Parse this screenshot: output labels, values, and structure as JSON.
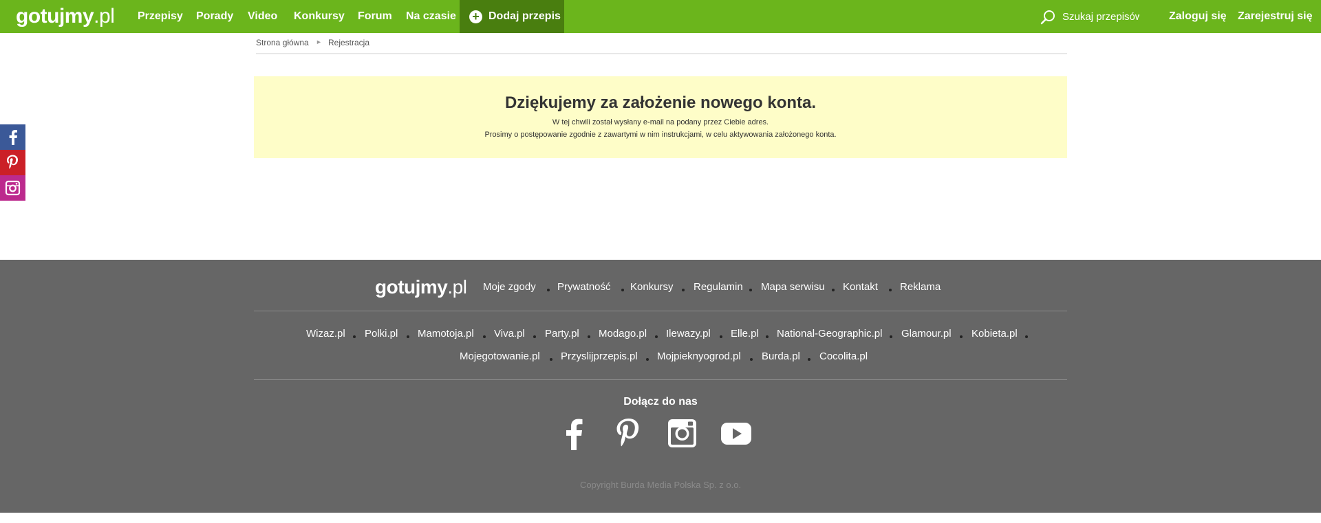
{
  "header": {
    "logo_main": "gotujmy",
    "logo_tld": ".pl",
    "nav": [
      "Przepisy",
      "Porady",
      "Video",
      "Konkursy",
      "Forum",
      "Na czasie"
    ],
    "add_recipe": "Dodaj przepis",
    "search_placeholder": "Szukaj przepisów",
    "login": "Zaloguj się",
    "register": "Zarejestruj się"
  },
  "breadcrumb": {
    "home": "Strona główna",
    "current": "Rejestracja"
  },
  "message": {
    "title": "Dziękujemy za założenie nowego konta.",
    "line1": "W tej chwili został wysłany e-mail na podany przez Ciebie adres.",
    "line2": "Prosimy o postępowanie zgodnie z zawartymi w nim instrukcjami, w celu aktywowania założonego konta."
  },
  "footer": {
    "logo_main": "gotujmy",
    "logo_tld": ".pl",
    "links": [
      "Moje zgody",
      "Prywatność",
      "Konkursy",
      "Regulamin",
      "Mapa serwisu",
      "Kontakt",
      "Reklama"
    ],
    "sites_row1": [
      "Wizaz.pl",
      "Polki.pl",
      "Mamotoja.pl",
      "Viva.pl",
      "Party.pl",
      "Modago.pl",
      "Ilewazy.pl",
      "Elle.pl",
      "National-Geographic.pl",
      "Glamour.pl",
      "Kobieta.pl"
    ],
    "sites_row2": [
      "Mojegotowanie.pl",
      "Przyslijprzepis.pl",
      "Mojpieknyogrod.pl",
      "Burda.pl",
      "Cocolita.pl"
    ],
    "join": "Dołącz do nas",
    "copyright": "Copyright Burda Media Polska Sp. z o.o."
  },
  "colors": {
    "brand_green": "#6bb51c",
    "add_button": "#497e0f",
    "message_bg": "#fefdc8",
    "footer_bg": "#666666",
    "facebook": "#3b5998",
    "pinterest": "#cb2027",
    "instagram": "#bc2a8d"
  },
  "icons": {
    "side": [
      "facebook-icon",
      "pinterest-icon",
      "instagram-icon"
    ],
    "footer": [
      "facebook-icon",
      "pinterest-icon",
      "instagram-icon",
      "youtube-icon"
    ],
    "search": "search-icon",
    "add": "plus-icon"
  }
}
